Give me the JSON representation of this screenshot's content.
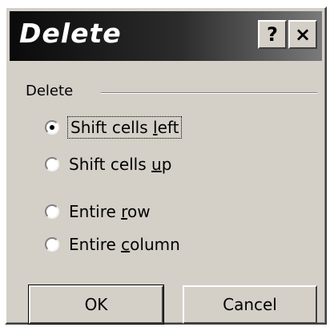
{
  "dialog": {
    "title": "Delete",
    "help_glyph": "?",
    "close_glyph": "×"
  },
  "group": {
    "label": "Delete"
  },
  "options": [
    {
      "pre": "Shift cells ",
      "ul": "l",
      "post": "eft",
      "selected": true
    },
    {
      "pre": "Shift cells ",
      "ul": "u",
      "post": "p",
      "selected": false
    },
    {
      "pre": "Entire ",
      "ul": "r",
      "post": "ow",
      "selected": false
    },
    {
      "pre": "Entire ",
      "ul": "c",
      "post": "olumn",
      "selected": false
    }
  ],
  "buttons": {
    "ok": "OK",
    "cancel": "Cancel"
  }
}
